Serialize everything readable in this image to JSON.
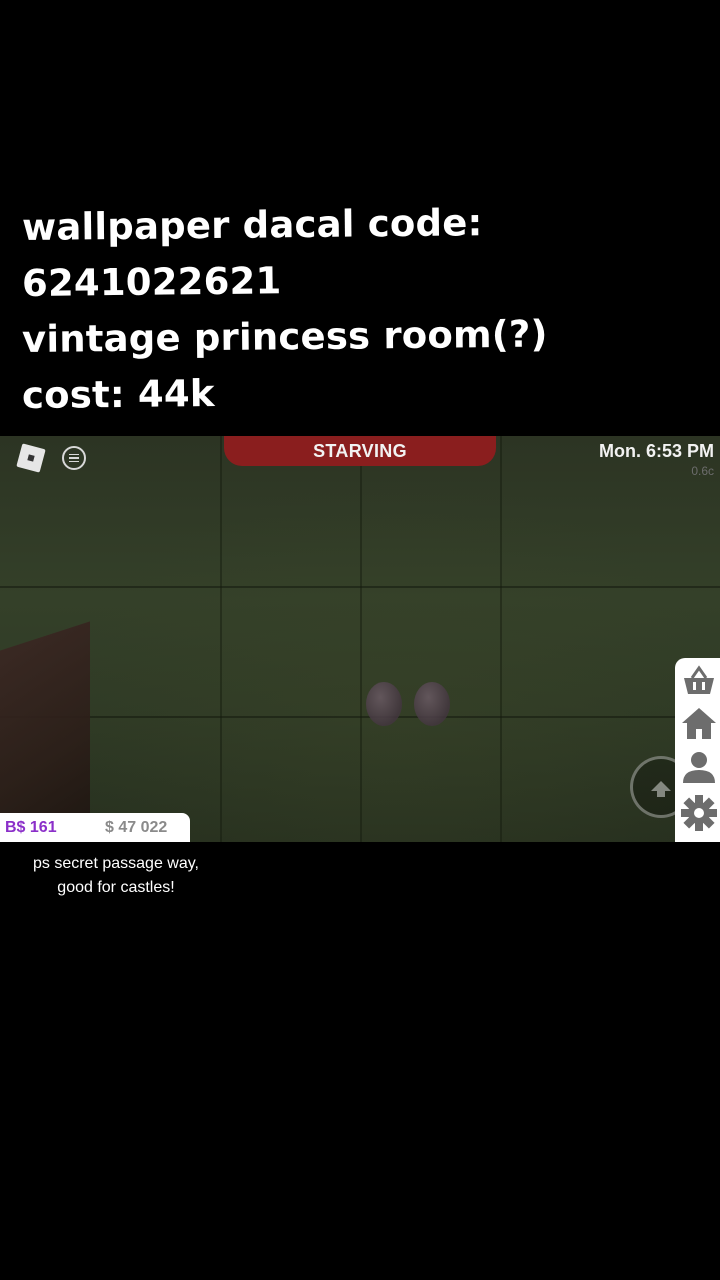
{
  "caption_top": {
    "line1": "wallpaper dacal code:",
    "line2": "6241022621",
    "line3": "vintage princess room(?)",
    "line4": "cost: 44k"
  },
  "hud": {
    "status": "STARVING",
    "time": "Mon. 6:53 PM",
    "sub_info": "0.6c",
    "bucks": "B$ 161",
    "cash": "$ 47 022"
  },
  "side_menu": {
    "items": [
      "build-mode",
      "home",
      "profile",
      "settings"
    ]
  },
  "caption_bottom": {
    "line1": "ps secret passage way,",
    "line2": "good for castles!"
  },
  "colors": {
    "status_bar": "#8a1e1e",
    "bucks": "#8b2fc9",
    "cash": "#8a8a8a",
    "side_icons": "#6d6d6d"
  }
}
